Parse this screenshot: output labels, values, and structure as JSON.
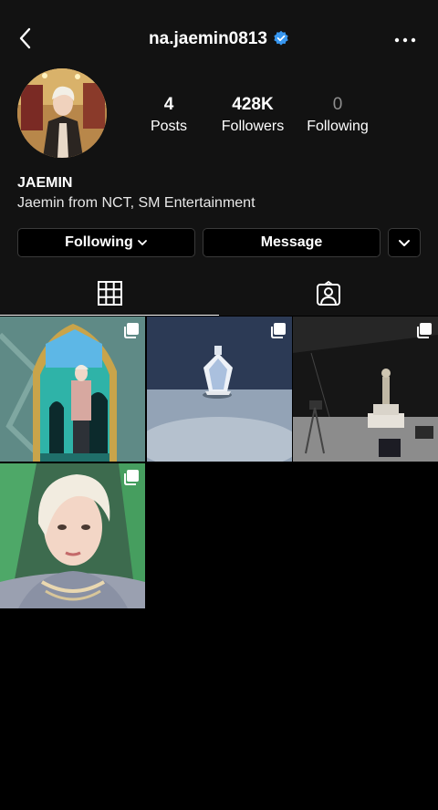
{
  "header": {
    "username": "na.jaemin0813",
    "back_icon": "chevron-left-icon",
    "verified_icon": "verified-badge-icon",
    "more_icon": "more-horizontal-icon"
  },
  "profile": {
    "stats": [
      {
        "value": "4",
        "label": "Posts"
      },
      {
        "value": "428K",
        "label": "Followers"
      },
      {
        "value": "0",
        "label": "Following"
      }
    ],
    "name": "JAEMIN",
    "bio": "Jaemin from NCT, SM Entertainment"
  },
  "actions": {
    "following_label": "Following",
    "message_label": "Message"
  },
  "tabs": [
    {
      "icon": "grid-icon",
      "active": true
    },
    {
      "icon": "tagged-person-icon",
      "active": false
    }
  ],
  "posts": [
    {
      "icon": "multiple-photos-icon"
    },
    {
      "icon": "multiple-photos-icon"
    },
    {
      "icon": "multiple-photos-icon"
    },
    {
      "icon": "multiple-photos-icon"
    }
  ],
  "colors": {
    "background": "#000000",
    "panel": "#121212",
    "verified": "#3897f0",
    "border": "#3a3a3a"
  }
}
